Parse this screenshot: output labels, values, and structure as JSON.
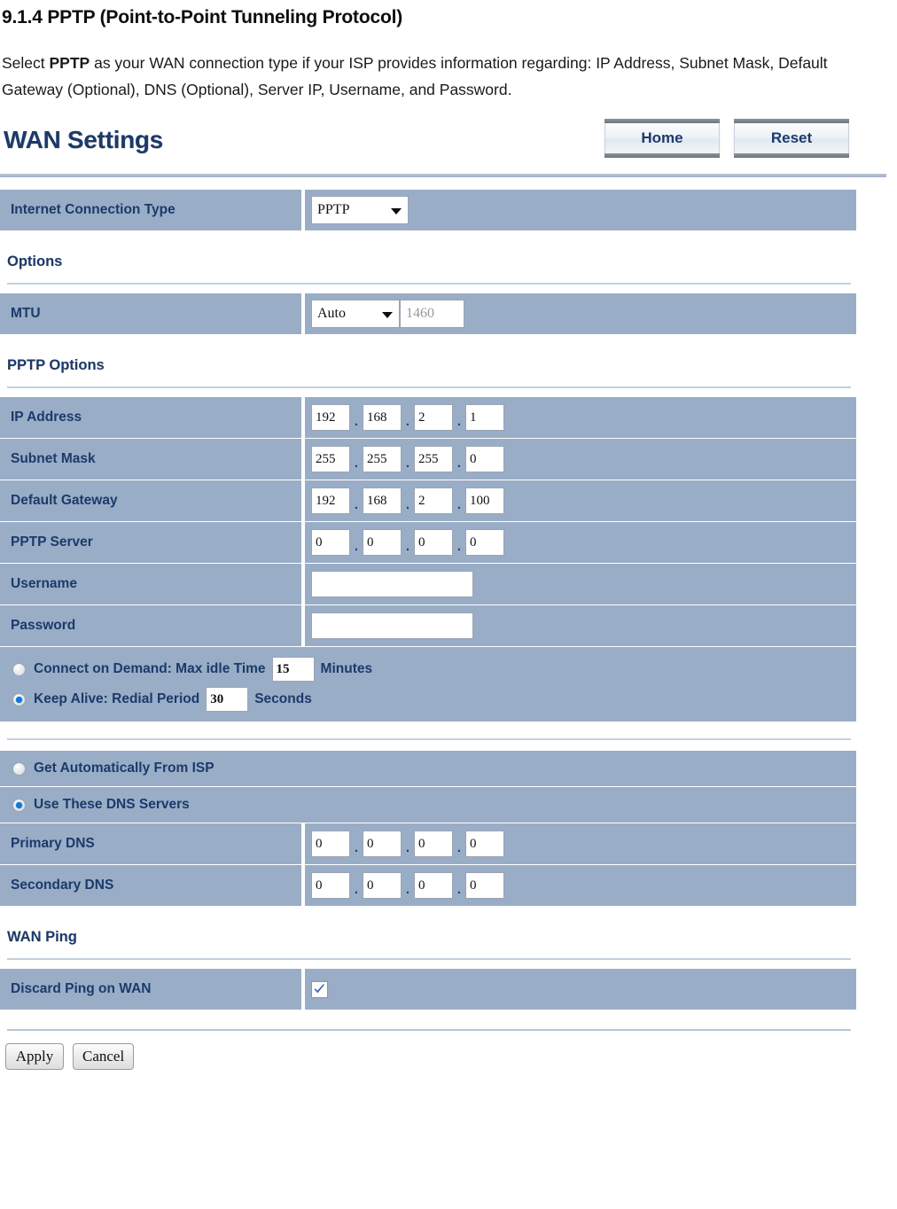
{
  "document": {
    "heading": "9.1.4 PPTP (Point-to-Point Tunneling Protocol)",
    "paragraph_part1": "Select ",
    "paragraph_bold": "PPTP",
    "paragraph_part2": " as your WAN connection type if your ISP provides information regarding: IP Address, Subnet Mask, Default Gateway (Optional), DNS (Optional), Server IP, Username, and Password."
  },
  "panel": {
    "title": "WAN Settings",
    "buttons": {
      "home": "Home",
      "reset": "Reset"
    }
  },
  "connection": {
    "label": "Internet Connection Type",
    "selected": "PPTP"
  },
  "options": {
    "section_title": "Options",
    "mtu": {
      "label": "MTU",
      "mode": "Auto",
      "value": "1460"
    }
  },
  "pptp": {
    "section_title": "PPTP Options",
    "fields": [
      {
        "label": "IP Address",
        "octets": [
          "192",
          "168",
          "2",
          "1"
        ]
      },
      {
        "label": "Subnet Mask",
        "octets": [
          "255",
          "255",
          "255",
          "0"
        ]
      },
      {
        "label": "Default Gateway",
        "octets": [
          "192",
          "168",
          "2",
          "100"
        ]
      },
      {
        "label": "PPTP Server",
        "octets": [
          "0",
          "0",
          "0",
          "0"
        ]
      }
    ],
    "username": {
      "label": "Username",
      "value": ""
    },
    "password": {
      "label": "Password",
      "value": ""
    },
    "connect_on_demand": {
      "label": "Connect on Demand: Max idle Time",
      "value": "15",
      "unit": "Minutes",
      "selected": false
    },
    "keep_alive": {
      "label": "Keep Alive: Redial Period",
      "value": "30",
      "unit": "Seconds",
      "selected": true
    }
  },
  "dns": {
    "auto_option": {
      "label": "Get Automatically From ISP",
      "selected": false
    },
    "manual_option": {
      "label": "Use These DNS Servers",
      "selected": true
    },
    "primary": {
      "label": "Primary DNS",
      "octets": [
        "0",
        "0",
        "0",
        "0"
      ]
    },
    "secondary": {
      "label": "Secondary DNS",
      "octets": [
        "0",
        "0",
        "0",
        "0"
      ]
    }
  },
  "wan_ping": {
    "section_title": "WAN Ping",
    "discard": {
      "label": "Discard Ping on WAN",
      "checked": true
    }
  },
  "footer": {
    "apply": "Apply",
    "cancel": "Cancel"
  },
  "colors": {
    "row_fill": "#9aadc6",
    "label_text": "#1b3a6b",
    "radio_dot": "#0f7ad6",
    "rule": "#c3cfde"
  }
}
